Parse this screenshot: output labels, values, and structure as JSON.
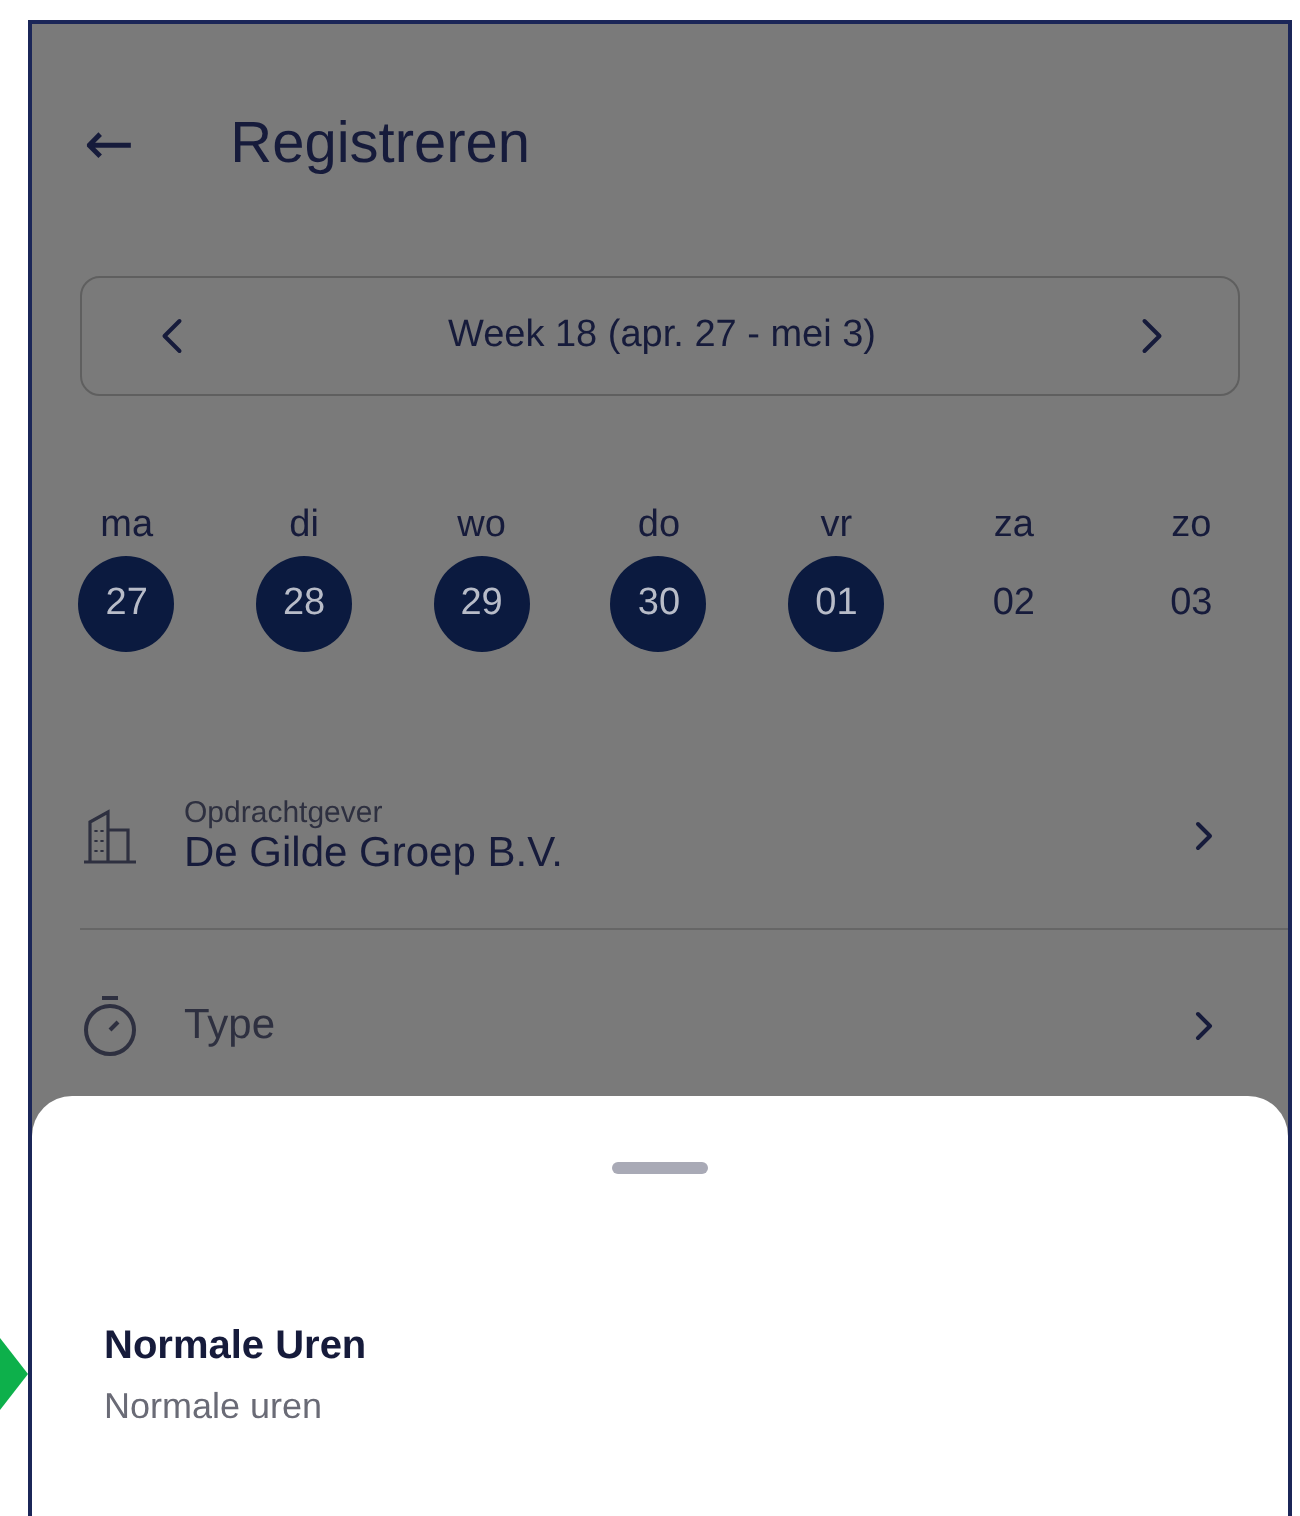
{
  "header": {
    "back": "←",
    "title": "Registreren"
  },
  "week": {
    "label": "Week 18 (apr. 27 - mei 3)"
  },
  "days": [
    {
      "name": "ma",
      "date": "27",
      "selected": true
    },
    {
      "name": "di",
      "date": "28",
      "selected": true
    },
    {
      "name": "wo",
      "date": "29",
      "selected": true
    },
    {
      "name": "do",
      "date": "30",
      "selected": true
    },
    {
      "name": "vr",
      "date": "01",
      "selected": true
    },
    {
      "name": "za",
      "date": "02",
      "selected": false
    },
    {
      "name": "zo",
      "date": "03",
      "selected": false
    }
  ],
  "fields": [
    {
      "kind": "client",
      "label": "Opdrachtgever",
      "value": "De Gilde Groep B.V."
    },
    {
      "kind": "type",
      "value": "Type"
    }
  ],
  "sheet": {
    "options": [
      {
        "title": "Normale Uren",
        "subtitle": "Normale uren"
      }
    ]
  }
}
